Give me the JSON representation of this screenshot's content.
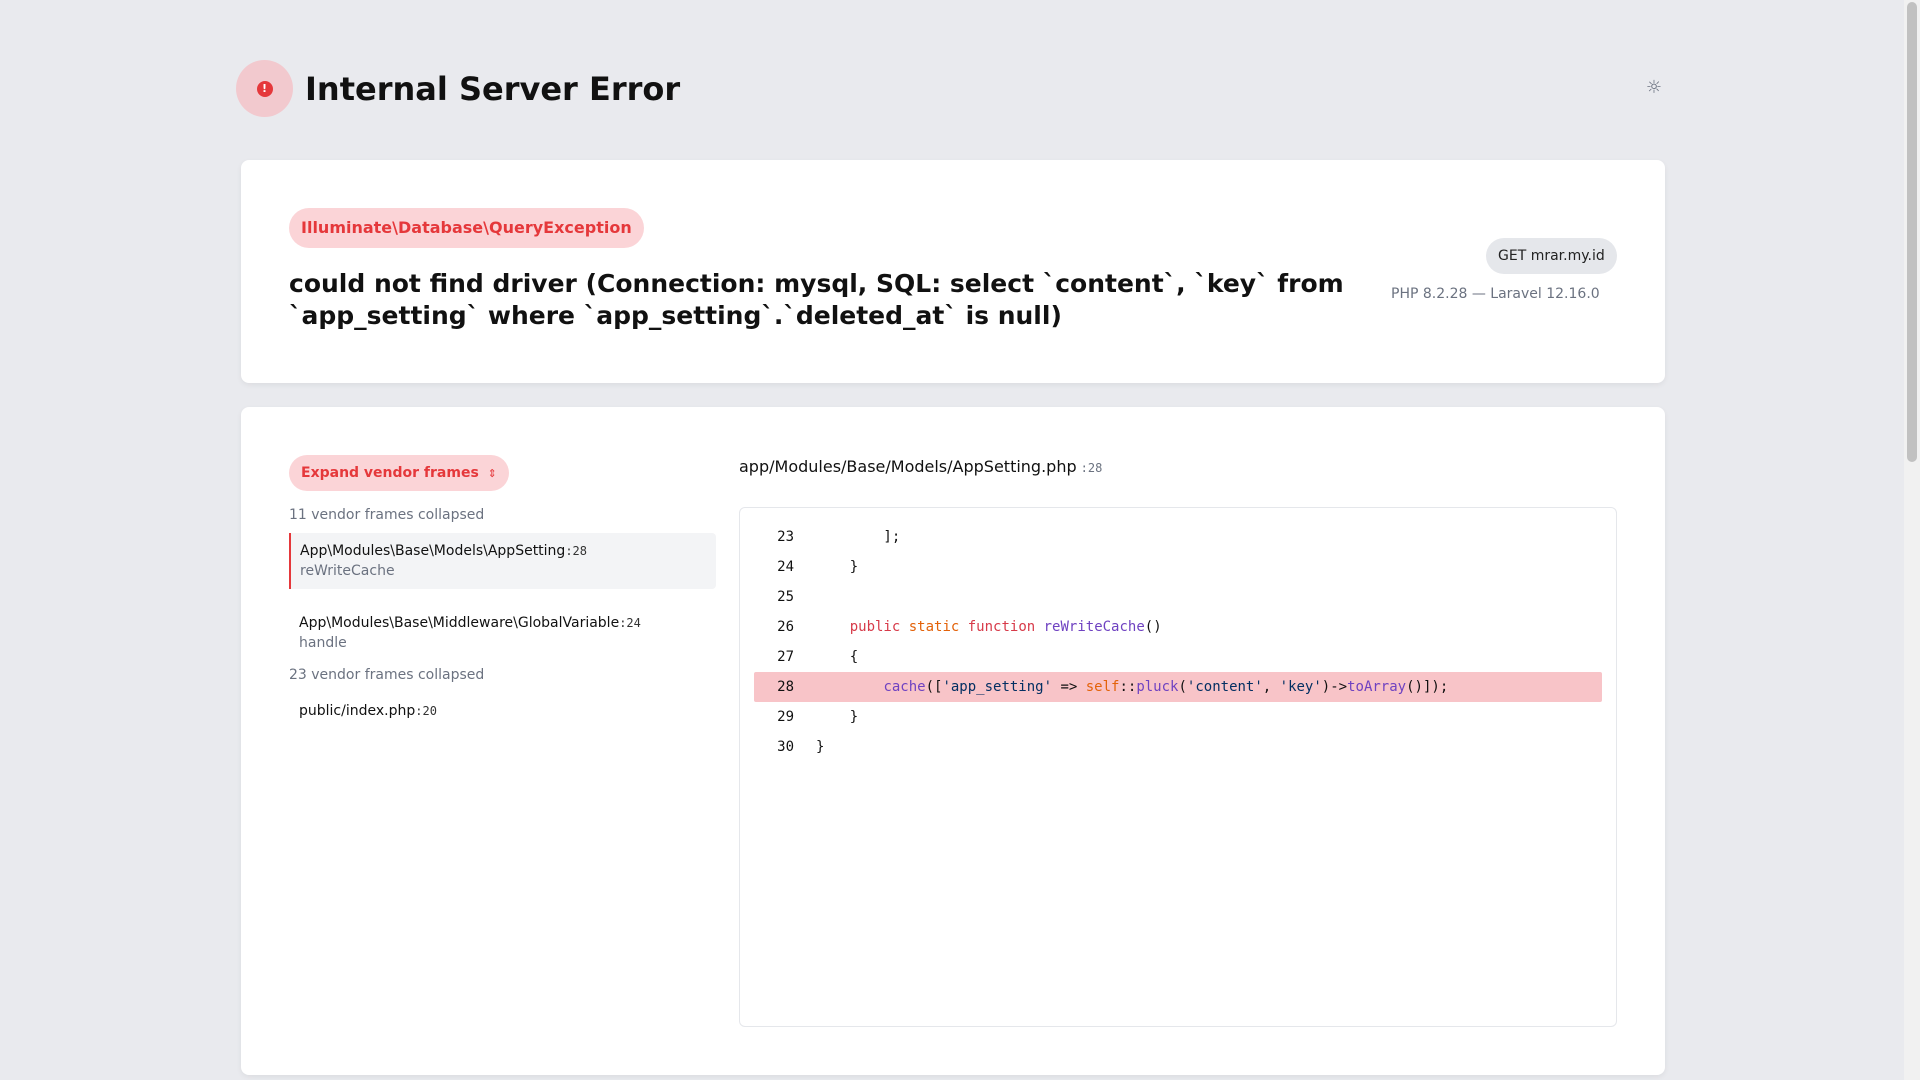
{
  "header": {
    "title": "Internal Server Error",
    "error_icon_glyph": "!",
    "theme_icon_glyph": "☼"
  },
  "exception": {
    "class": "Illuminate\\Database\\QueryException",
    "message": "could not find driver (Connection: mysql, SQL: select `content`, `key` from `app_setting` where `app_setting`.`deleted_at` is null)",
    "request": "GET mrar.my.id",
    "versions": "PHP 8.2.28 — Laravel 12.16.0"
  },
  "trace": {
    "expand_label": "Expand vendor frames",
    "collapsed_top": "11 vendor frames collapsed",
    "collapsed_mid": "23 vendor frames collapsed",
    "frames": [
      {
        "class": "App\\Modules\\Base\\Models\\AppSetting",
        "line": ":28",
        "method": "reWriteCache"
      },
      {
        "class": "App\\Modules\\Base\\Middleware\\GlobalVariable",
        "line": ":24",
        "method": "handle"
      },
      {
        "class": "public/index.php",
        "line": ":20",
        "method": ""
      }
    ]
  },
  "code": {
    "file": "app/Modules/Base/Models/AppSetting.php",
    "file_line": ":28",
    "lines": [
      {
        "num": "23",
        "tokens": [
          {
            "t": "        ];",
            "c": "t-def"
          }
        ]
      },
      {
        "num": "24",
        "tokens": [
          {
            "t": "    }",
            "c": "t-def"
          }
        ]
      },
      {
        "num": "25",
        "tokens": [
          {
            "t": "",
            "c": "t-def"
          }
        ]
      },
      {
        "num": "26",
        "tokens": [
          {
            "t": "    ",
            "c": "t-def"
          },
          {
            "t": "public",
            "c": "t-kw"
          },
          {
            "t": " ",
            "c": "t-def"
          },
          {
            "t": "static",
            "c": "t-mod"
          },
          {
            "t": " ",
            "c": "t-def"
          },
          {
            "t": "function",
            "c": "t-kw"
          },
          {
            "t": " ",
            "c": "t-def"
          },
          {
            "t": "reWriteCache",
            "c": "t-fn"
          },
          {
            "t": "()",
            "c": "t-def"
          }
        ]
      },
      {
        "num": "27",
        "tokens": [
          {
            "t": "    {",
            "c": "t-def"
          }
        ]
      },
      {
        "num": "28",
        "highlight": true,
        "tokens": [
          {
            "t": "        ",
            "c": "t-def"
          },
          {
            "t": "cache",
            "c": "t-fn"
          },
          {
            "t": "([",
            "c": "t-def"
          },
          {
            "t": "'app_setting'",
            "c": "t-str"
          },
          {
            "t": " => ",
            "c": "t-def"
          },
          {
            "t": "self",
            "c": "t-mod"
          },
          {
            "t": "::",
            "c": "t-def"
          },
          {
            "t": "pluck",
            "c": "t-fn"
          },
          {
            "t": "(",
            "c": "t-def"
          },
          {
            "t": "'content'",
            "c": "t-str"
          },
          {
            "t": ", ",
            "c": "t-def"
          },
          {
            "t": "'key'",
            "c": "t-str"
          },
          {
            "t": ")->",
            "c": "t-def"
          },
          {
            "t": "toArray",
            "c": "t-fn"
          },
          {
            "t": "()]);",
            "c": "t-def"
          }
        ]
      },
      {
        "num": "29",
        "tokens": [
          {
            "t": "    }",
            "c": "t-def"
          }
        ]
      },
      {
        "num": "30",
        "tokens": [
          {
            "t": "}",
            "c": "t-def"
          }
        ]
      }
    ]
  },
  "colors": {
    "accent": "#e5383b",
    "accent_bg": "#fbd4d7",
    "page_bg": "#e9eaee"
  }
}
